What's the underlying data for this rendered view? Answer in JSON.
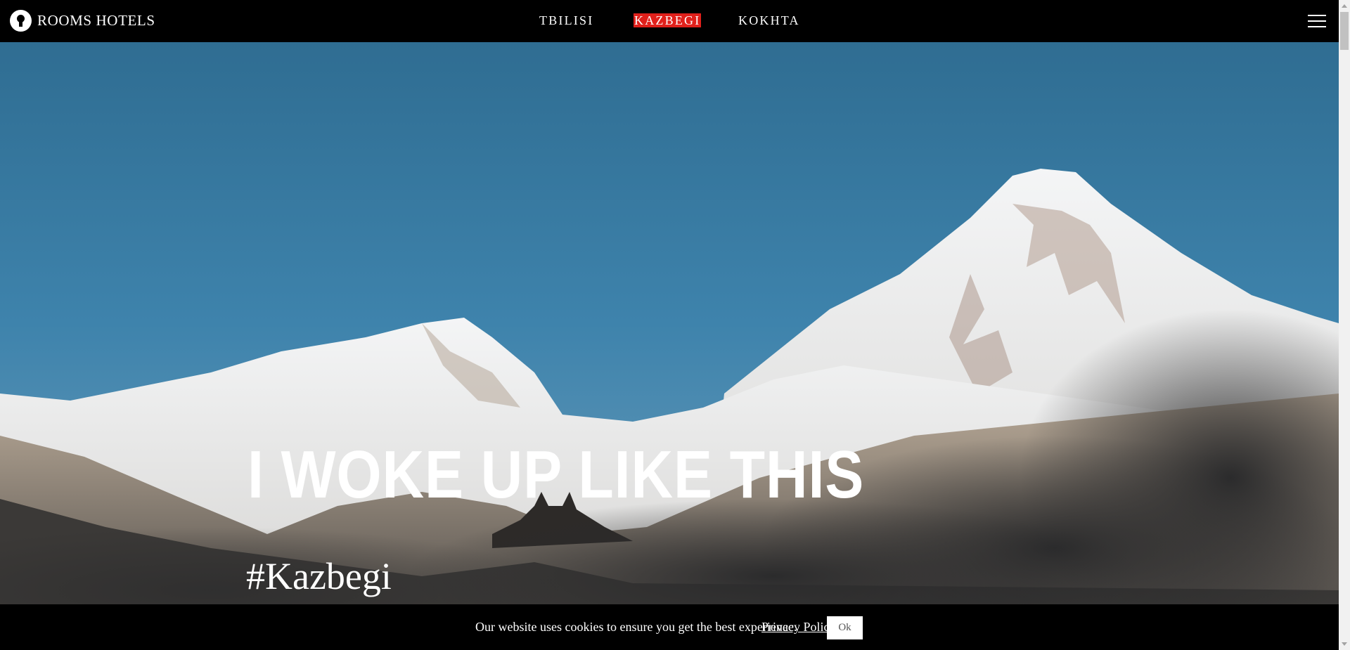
{
  "header": {
    "logo_text": "ROOMS HOTELS",
    "nav": [
      {
        "label": "TBILISI",
        "active": false
      },
      {
        "label": "KAZBEGI",
        "active": true
      },
      {
        "label": "KOKHTA",
        "active": false
      }
    ],
    "menu_icon": "hamburger-icon"
  },
  "hero": {
    "headline": "I WOKE UP LIKE THIS",
    "hashtag": "#Kazbegi"
  },
  "cookie_banner": {
    "message": "Our website uses cookies to ensure you get the best experience.",
    "link_label": "Privacy Policy",
    "button_label": "Ok"
  },
  "colors": {
    "active_nav": "#e0201b",
    "header_bg": "#000000",
    "sky": "#3e82ab"
  }
}
